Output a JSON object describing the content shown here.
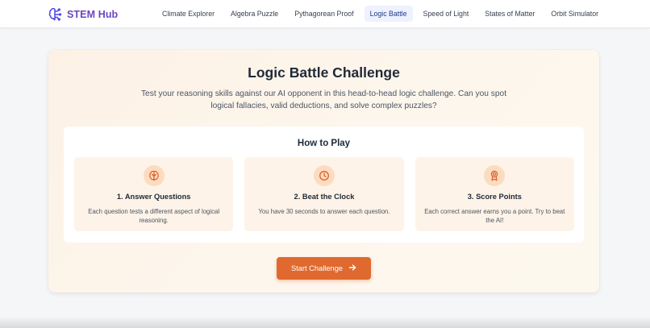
{
  "header": {
    "brand": "STEM Hub",
    "brand_icon": "brain-circuit-icon",
    "nav": [
      {
        "label": "Climate Explorer",
        "active": false
      },
      {
        "label": "Algebra Puzzle",
        "active": false
      },
      {
        "label": "Pythagorean Proof",
        "active": false
      },
      {
        "label": "Logic Battle",
        "active": true
      },
      {
        "label": "Speed of Light",
        "active": false
      },
      {
        "label": "States of Matter",
        "active": false
      },
      {
        "label": "Orbit Simulator",
        "active": false
      }
    ]
  },
  "main": {
    "title": "Logic Battle Challenge",
    "subtitle": "Test your reasoning skills against our AI opponent in this head-to-head logic challenge. Can you spot logical fallacies, valid deductions, and solve complex puzzles?",
    "how_to_play": {
      "title": "How to Play",
      "steps": [
        {
          "icon": "brain-icon",
          "title": "1. Answer Questions",
          "description": "Each question tests a different aspect of logical reasoning."
        },
        {
          "icon": "clock-icon",
          "title": "2. Beat the Clock",
          "description": "You have 30 seconds to answer each question."
        },
        {
          "icon": "award-icon",
          "title": "3. Score Points",
          "description": "Each correct answer earns you a point. Try to beat the AI!"
        }
      ]
    },
    "start_button": {
      "label": "Start Challenge",
      "icon": "arrow-right-icon"
    }
  },
  "colors": {
    "brand": "#6b46c1",
    "accent": "#e0692f",
    "active_nav_bg": "#eef2ff",
    "step_bg": "#fef3e8",
    "icon_circle_bg": "#fcdcc0"
  }
}
